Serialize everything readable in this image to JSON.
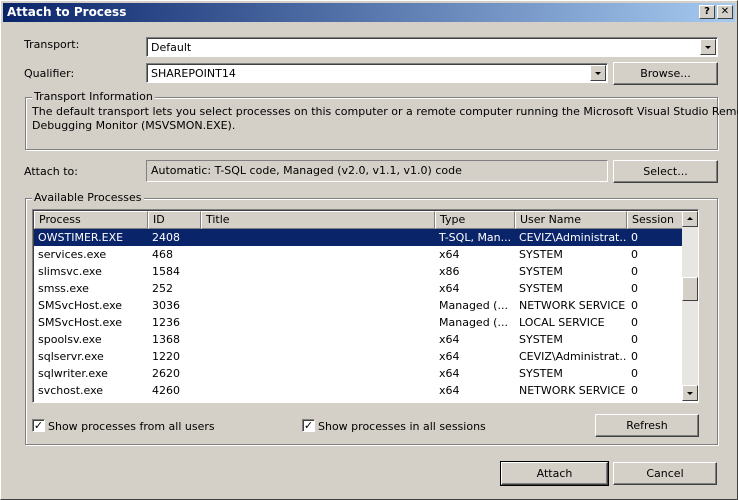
{
  "window": {
    "title": "Attach to Process",
    "help_label": "?",
    "close_label": "✕"
  },
  "transport": {
    "label": "Transport:",
    "value": "Default"
  },
  "qualifier": {
    "label": "Qualifier:",
    "value": "SHAREPOINT14",
    "browse_label": "Browse..."
  },
  "transport_info": {
    "title": "Transport Information",
    "text_line1": "The default transport lets you select processes on this computer or a remote computer running the Microsoft Visual Studio Remote",
    "text_line2": "Debugging Monitor (MSVSMON.EXE)."
  },
  "attach_to": {
    "label": "Attach to:",
    "value": "Automatic: T-SQL code, Managed (v2.0, v1.1, v1.0) code",
    "select_label": "Select..."
  },
  "processes": {
    "title": "Available Processes",
    "columns": [
      "Process",
      "ID",
      "Title",
      "Type",
      "User Name",
      "Session"
    ],
    "rows": [
      [
        "OWSTIMER.EXE",
        "2408",
        "",
        "T-SQL, Man...",
        "CEVIZ\\Administrat...",
        "0"
      ],
      [
        "services.exe",
        "468",
        "",
        "x64",
        "SYSTEM",
        "0"
      ],
      [
        "slimsvc.exe",
        "1584",
        "",
        "x86",
        "SYSTEM",
        "0"
      ],
      [
        "smss.exe",
        "252",
        "",
        "x64",
        "SYSTEM",
        "0"
      ],
      [
        "SMSvcHost.exe",
        "3036",
        "",
        "Managed (...",
        "NETWORK SERVICE",
        "0"
      ],
      [
        "SMSvcHost.exe",
        "1236",
        "",
        "Managed (...",
        "LOCAL SERVICE",
        "0"
      ],
      [
        "spoolsv.exe",
        "1368",
        "",
        "x64",
        "SYSTEM",
        "0"
      ],
      [
        "sqlservr.exe",
        "1220",
        "",
        "x64",
        "CEVIZ\\Administrat...",
        "0"
      ],
      [
        "sqlwriter.exe",
        "2620",
        "",
        "x64",
        "SYSTEM",
        "0"
      ],
      [
        "svchost.exe",
        "4260",
        "",
        "x64",
        "NETWORK SERVICE",
        "0"
      ]
    ],
    "selected_row": 0
  },
  "options": {
    "show_all_users": {
      "label": "Show processes from all users",
      "checked": true
    },
    "show_all_sessions": {
      "label": "Show processes in all sessions",
      "checked": true
    },
    "check_glyph": "✓"
  },
  "buttons": {
    "refresh": "Refresh",
    "attach": "Attach",
    "cancel": "Cancel"
  },
  "colors": {
    "selection": "#0a246a",
    "titlebar_start": "#0a246a",
    "titlebar_end": "#a6caf0"
  }
}
